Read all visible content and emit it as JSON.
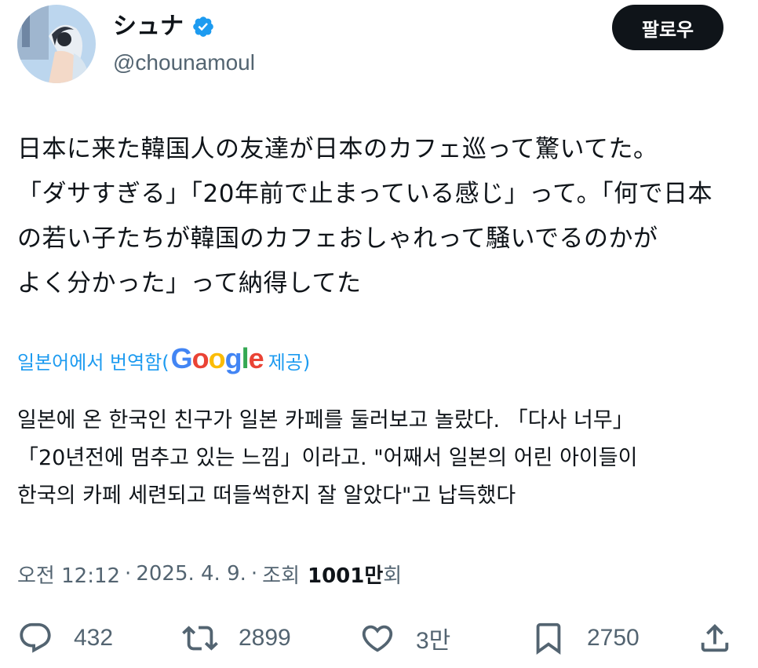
{
  "author": {
    "display_name": "シュナ",
    "handle": "@chounamoul",
    "verified": true,
    "verified_color": "#1d9bf0"
  },
  "follow_button_label": "팔로우",
  "tweet_lines": [
    "日本に来た韓国人の友達が日本のカフェ巡って驚いてた。",
    "「ダサすぎる」「20年前で止まっている感じ」って。「何で日本",
    "の若い子たちが韓国のカフェおしゃれって騒いでるのかが",
    "よく分かった」って納得してた"
  ],
  "translation_notice": {
    "prefix": "일본어에서 번역함(",
    "google_letters": [
      "G",
      "o",
      "o",
      "g",
      "l",
      "e"
    ],
    "suffix": " 제공)"
  },
  "translation_lines": [
    "일본에 온 한국인 친구가 일본 카페를 둘러보고 놀랐다. 「다사 너무」",
    "「20년전에 멈추고 있는 느낌」이라고. \"어째서 일본의 어린 아이들이",
    "한국의 카페 세련되고 떠들썩한지 잘 알았다\"고 납득했다"
  ],
  "meta": {
    "time": "오전 12:12",
    "date": "2025. 4. 9.",
    "views_label_prefix": "조회",
    "views_count": "1001만",
    "views_label_suffix": "회",
    "separator": "·"
  },
  "actions": {
    "reply_count": "432",
    "retweet_count": "2899",
    "like_count": "3만",
    "bookmark_count": "2750"
  },
  "icons": {
    "reply": "reply-icon",
    "retweet": "retweet-icon",
    "like": "heart-icon",
    "bookmark": "bookmark-icon",
    "share": "share-icon",
    "verified": "verified-badge-icon"
  },
  "colors": {
    "text": "#0f1419",
    "secondary": "#536471",
    "link": "#1d9bf0",
    "button_bg": "#0f1419"
  }
}
